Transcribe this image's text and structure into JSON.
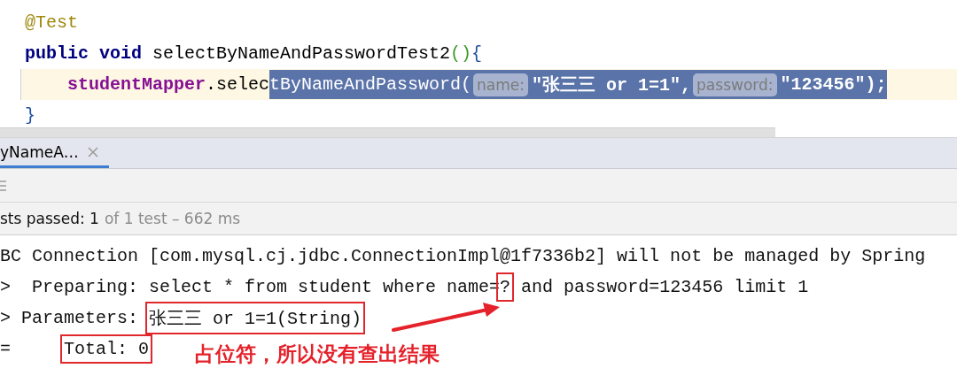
{
  "editor": {
    "lines": [
      {
        "current": false,
        "tokens": [
          {
            "text": "@Test",
            "kind": "annotation",
            "selected": false
          }
        ]
      },
      {
        "current": false,
        "tokens": [
          {
            "text": "public",
            "kind": "keyword",
            "selected": false
          },
          {
            "text": "void",
            "kind": "keyword",
            "selected": false
          },
          {
            "text": "selectByNameAndPasswordTest2",
            "kind": "plain",
            "selected": false
          },
          {
            "text": "()",
            "kind": "paren",
            "selected": false
          },
          {
            "text": "{",
            "kind": "brace",
            "selected": false
          }
        ],
        "children": [
          {
            "current": true,
            "tokens": [
              {
                "text": "studentMapper",
                "kind": "field",
                "selected": false
              },
              {
                "text": ".selec",
                "kind": "plain",
                "selected": false
              },
              {
                "text": "tByNameAndPassword(",
                "kind": "plain",
                "selected": true
              },
              {
                "text": "name:",
                "kind": "hint",
                "selected": true
              },
              {
                "text": "\"张三三 or 1=1\",",
                "kind": "string",
                "selected": true
              },
              {
                "text": "password:",
                "kind": "hint",
                "selected": true
              },
              {
                "text": "\"123456\");",
                "kind": "string",
                "selected": true
              }
            ]
          }
        ]
      },
      {
        "current": false,
        "tokens": [
          {
            "text": "}",
            "kind": "brace",
            "selected": false
          }
        ]
      }
    ]
  },
  "run_panel": {
    "tab": {
      "label": "yNameA…",
      "selected": true
    },
    "status": {
      "passed": "sts passed: 1",
      "detail": "of 1 test – 662 ms"
    },
    "console": [
      [
        {
          "text": "BC Connection [com.mysql.cj.jdbc.ConnectionImpl@1f7336b2] will not be managed by Spring",
          "boxed": false
        }
      ],
      [
        {
          "text": ">  Preparing: select * from student where name=",
          "boxed": false
        },
        {
          "text": "?",
          "boxed": true
        },
        {
          "text": " and password=123456 limit 1",
          "boxed": false
        }
      ],
      [
        {
          "text": "> Parameters: ",
          "boxed": false
        },
        {
          "text": "张三三 or 1=1(String)",
          "boxed": true
        }
      ],
      [
        {
          "text": "=     ",
          "boxed": false
        },
        {
          "text": "Total: 0",
          "boxed": true
        }
      ]
    ],
    "note": "占位符，所以没有查出结果"
  }
}
